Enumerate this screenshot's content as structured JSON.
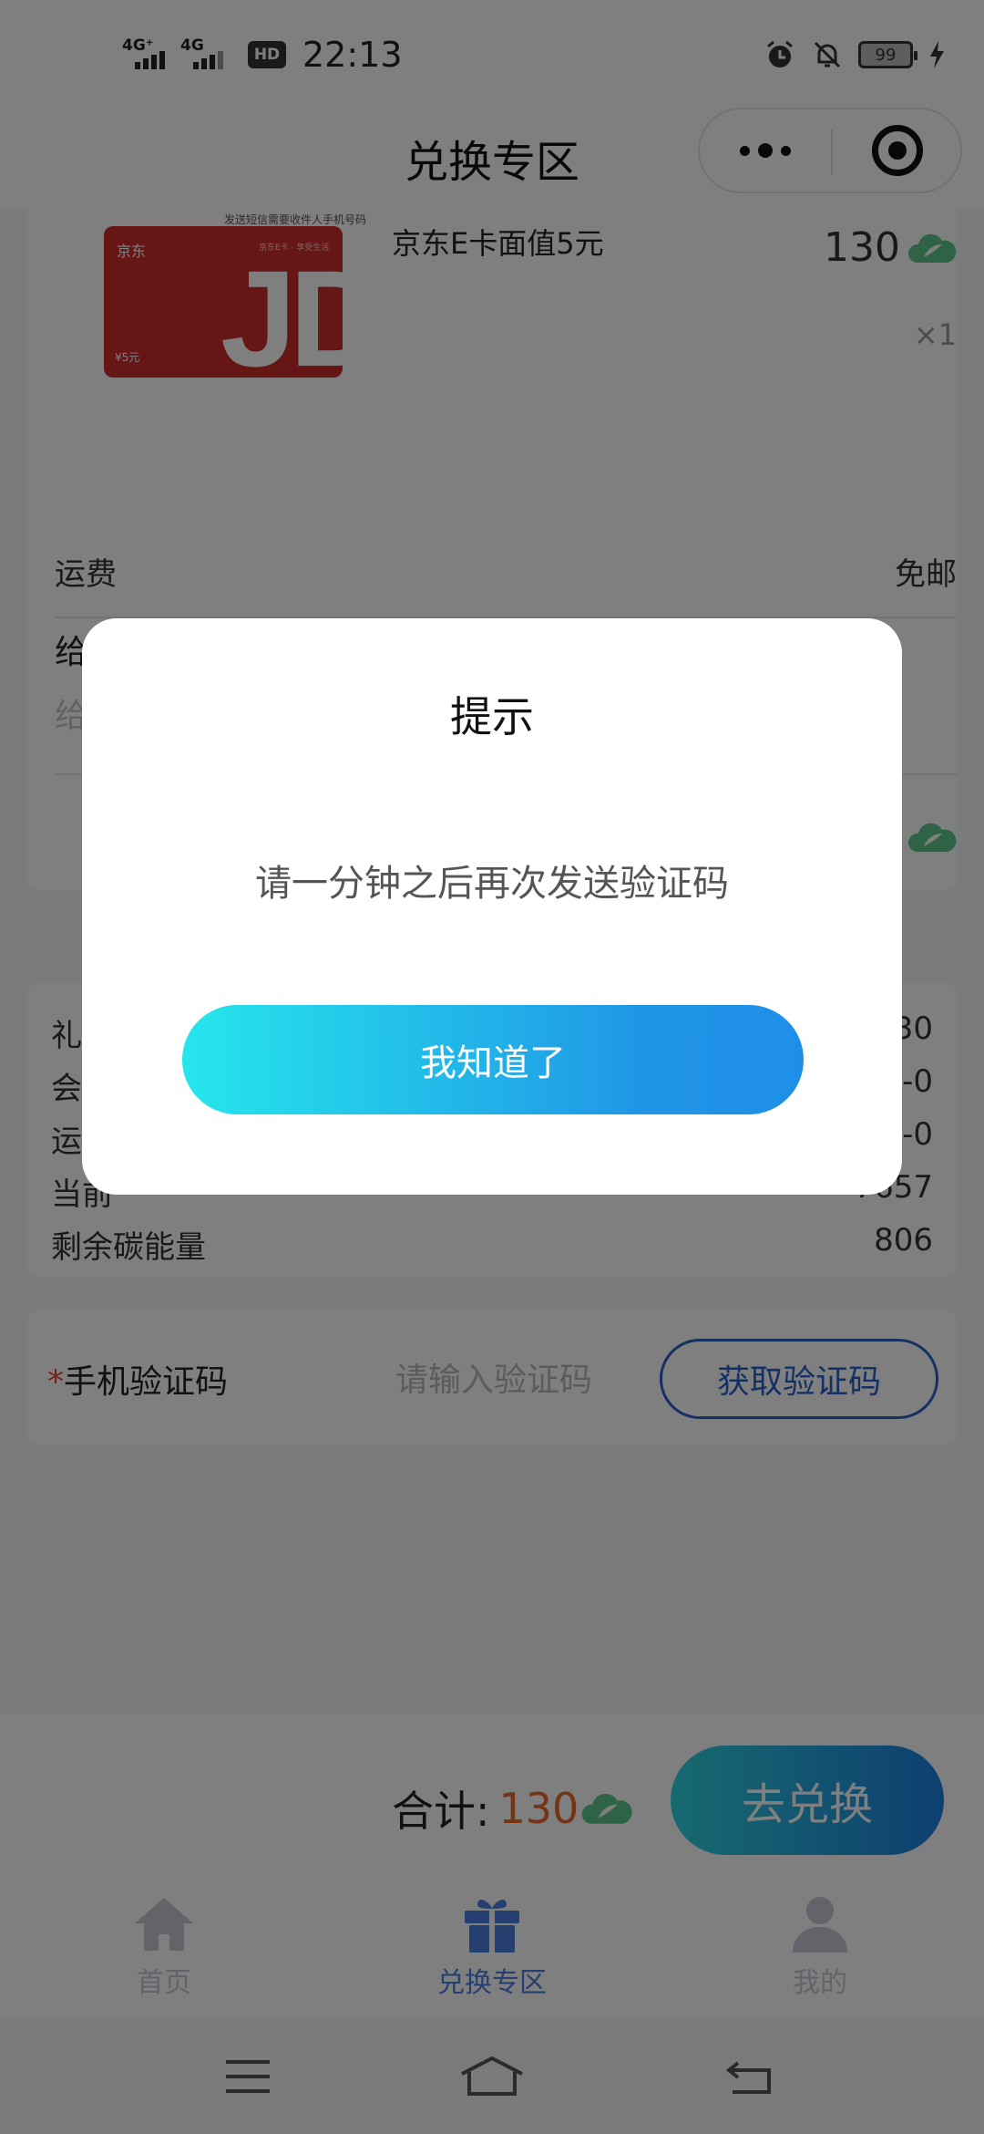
{
  "status_bar": {
    "net1": "4G⁺",
    "net2": "4G",
    "hd_label": "HD",
    "time": "22:13",
    "battery": "99"
  },
  "nav": {
    "title": "兑换专区"
  },
  "product": {
    "card_hint": "发送短信需要收件人手机号码",
    "jd_brand": "京东",
    "jd_slogan": "京东E卡 · 享受生活",
    "jd_letters": "JD",
    "jd_value": "¥5元",
    "name": "京东E卡面值5元",
    "price": "130",
    "quantity": "×1",
    "shipping_label": "运费",
    "shipping_value": "免邮",
    "message_label": "给",
    "message_placeholder": "给"
  },
  "summary": {
    "rows": [
      {
        "label": "礼",
        "value": "30"
      },
      {
        "label": "会",
        "value": "-0"
      },
      {
        "label": "运",
        "value": "-0"
      },
      {
        "label": "当前",
        "value": "7657"
      },
      {
        "label": "剩余碳能量",
        "value": "806"
      }
    ]
  },
  "verify": {
    "required_mark": "*",
    "label": "手机验证码",
    "placeholder": "请输入验证码",
    "get_code_button": "获取验证码"
  },
  "submit_bar": {
    "total_label": "合计:",
    "total_value": "130",
    "submit_button": "去兑换"
  },
  "tabs": [
    {
      "label": "首页",
      "icon": "home-icon",
      "active": false
    },
    {
      "label": "兑换专区",
      "icon": "gift-icon",
      "active": true
    },
    {
      "label": "我的",
      "icon": "user-icon",
      "active": false
    }
  ],
  "dialog": {
    "title": "提示",
    "message": "请一分钟之后再次发送验证码",
    "confirm_button": "我知道了"
  },
  "colors": {
    "accent_blue": "#2a63c9",
    "tab_active": "#4a7fe3",
    "tab_inactive": "#c4c8d4",
    "price_orange": "#e8692b",
    "leaf_green": "#5cc98a",
    "jd_red": "#cf2d2d"
  }
}
